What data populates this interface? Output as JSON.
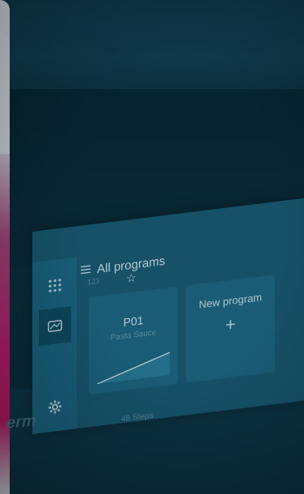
{
  "screen": {
    "title": "All programs",
    "program_card": {
      "name": "P01",
      "subtitle": "Pasta Sauce",
      "footer": "48 Steps"
    },
    "new_program_card": {
      "label": "New program",
      "plus": "+"
    },
    "tiny_label": "123",
    "icons": {
      "rail_top": "grid-icon",
      "rail_middle": "program-icon",
      "rail_bottom": "gear-icon",
      "title": "list-icon",
      "star": "star-icon"
    }
  },
  "brand_text": "erm",
  "colors": {
    "tint": "#0a2a36",
    "screen": "#1a5870",
    "accent_magenta": "#c2125f"
  }
}
